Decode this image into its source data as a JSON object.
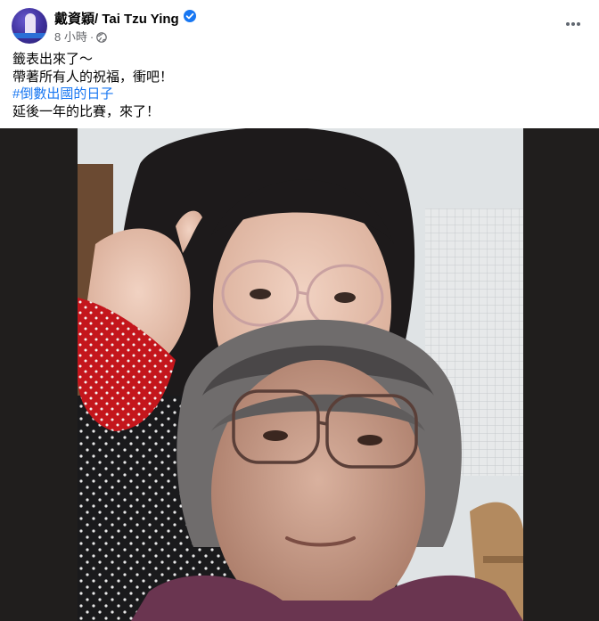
{
  "post": {
    "author_name": "戴資穎/ Tai Tzu Ying",
    "verified_icon": "verified-badge-icon",
    "time": "8 小時",
    "separator": "·",
    "privacy_icon": "globe-icon",
    "more_icon": "more-options-icon",
    "text_lines": [
      "籤表出來了～",
      "帶著所有人的祝福，衝吧！",
      "#倒數出國的日子",
      "延後一年的比賽，來了！"
    ],
    "photo_icon": "selfie-photo",
    "colors": {
      "verified": "#1877f2",
      "hashtag": "#1877f2",
      "meta_text": "#65676b",
      "media_background": "#201e1d"
    }
  }
}
